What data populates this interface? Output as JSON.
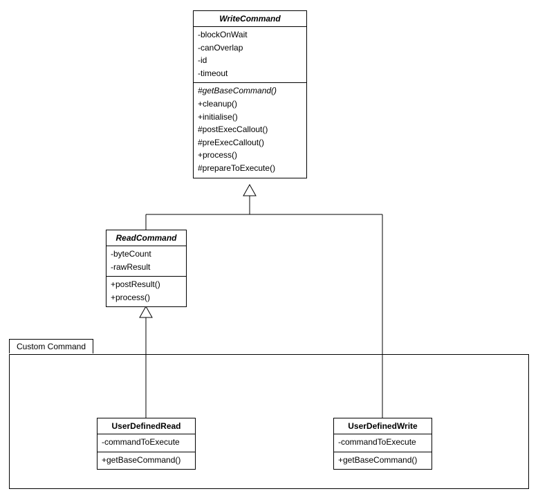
{
  "package": {
    "label": "Custom Command"
  },
  "classes": {
    "writeCommand": {
      "name": "WriteCommand",
      "abstract": true,
      "attrs": [
        {
          "text": "-blockOnWait",
          "italic": false
        },
        {
          "text": "-canOverlap",
          "italic": false
        },
        {
          "text": "-id",
          "italic": false
        },
        {
          "text": "-timeout",
          "italic": false
        }
      ],
      "ops": [
        {
          "text": "#getBaseCommand()",
          "italic": true
        },
        {
          "text": "+cleanup()",
          "italic": false
        },
        {
          "text": "+initialise()",
          "italic": false
        },
        {
          "text": "#postExecCallout()",
          "italic": false
        },
        {
          "text": "#preExecCallout()",
          "italic": false
        },
        {
          "text": "+process()",
          "italic": false
        },
        {
          "text": "#prepareToExecute()",
          "italic": false
        }
      ]
    },
    "readCommand": {
      "name": "ReadCommand",
      "abstract": true,
      "attrs": [
        {
          "text": "-byteCount",
          "italic": false
        },
        {
          "text": "-rawResult",
          "italic": false
        }
      ],
      "ops": [
        {
          "text": "+postResult()",
          "italic": false
        },
        {
          "text": "+process()",
          "italic": false
        }
      ]
    },
    "userDefinedRead": {
      "name": "UserDefinedRead",
      "abstract": false,
      "attrs": [
        {
          "text": "-commandToExecute",
          "italic": false
        }
      ],
      "ops": [
        {
          "text": "+getBaseCommand()",
          "italic": false
        }
      ]
    },
    "userDefinedWrite": {
      "name": "UserDefinedWrite",
      "abstract": false,
      "attrs": [
        {
          "text": "-commandToExecute",
          "italic": false
        }
      ],
      "ops": [
        {
          "text": "+getBaseCommand()",
          "italic": false
        }
      ]
    }
  },
  "chart_data": {
    "type": "uml-class-diagram",
    "package": "Custom Command",
    "classes": [
      {
        "name": "WriteCommand",
        "abstract": true,
        "attributes": [
          "-blockOnWait",
          "-canOverlap",
          "-id",
          "-timeout"
        ],
        "operations": [
          "#getBaseCommand()",
          "+cleanup()",
          "+initialise()",
          "#postExecCallout()",
          "#preExecCallout()",
          "+process()",
          "#prepareToExecute()"
        ],
        "abstractOperations": [
          "#getBaseCommand()"
        ]
      },
      {
        "name": "ReadCommand",
        "abstract": true,
        "attributes": [
          "-byteCount",
          "-rawResult"
        ],
        "operations": [
          "+postResult()",
          "+process()"
        ]
      },
      {
        "name": "UserDefinedRead",
        "abstract": false,
        "inPackage": "Custom Command",
        "attributes": [
          "-commandToExecute"
        ],
        "operations": [
          "+getBaseCommand()"
        ]
      },
      {
        "name": "UserDefinedWrite",
        "abstract": false,
        "inPackage": "Custom Command",
        "attributes": [
          "-commandToExecute"
        ],
        "operations": [
          "+getBaseCommand()"
        ]
      }
    ],
    "generalizations": [
      {
        "child": "ReadCommand",
        "parent": "WriteCommand"
      },
      {
        "child": "UserDefinedWrite",
        "parent": "WriteCommand"
      },
      {
        "child": "UserDefinedRead",
        "parent": "ReadCommand"
      }
    ]
  }
}
